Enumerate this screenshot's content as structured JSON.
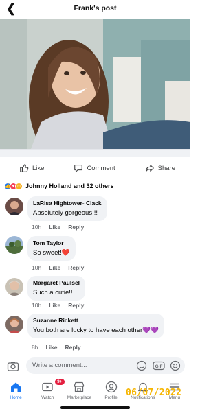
{
  "header": {
    "title": "Frank's post"
  },
  "actions": {
    "like": "Like",
    "comment": "Comment",
    "share": "Share"
  },
  "reactions": {
    "summary": "Johnny Holland and 32 others"
  },
  "comments": [
    {
      "name": "LaRisa Hightower- Clack",
      "text": "Absolutely gorgeous!!!",
      "time": "10h",
      "like": "Like",
      "reply": "Reply"
    },
    {
      "name": "Tom Taylor",
      "text": "So sweet!❤️",
      "time": "10h",
      "like": "Like",
      "reply": "Reply"
    },
    {
      "name": "Margaret Paulsel",
      "text": "Such a cutie!!",
      "time": "10h",
      "like": "Like",
      "reply": "Reply"
    },
    {
      "name": "Suzanne Rickett",
      "text": "You both are lucky to have each other💜💜",
      "time": "8h",
      "like": "Like",
      "reply": "Reply"
    }
  ],
  "composer": {
    "placeholder": "Write a comment..."
  },
  "tabs": [
    {
      "label": "Home"
    },
    {
      "label": "Watch",
      "badge": "9+"
    },
    {
      "label": "Marketplace"
    },
    {
      "label": "Profile"
    },
    {
      "label": "Notifications"
    },
    {
      "label": "Menu"
    }
  ],
  "stamp": "06/07/2022",
  "colors": {
    "accent": "#1877f2",
    "badge": "#e41e3f",
    "bubble": "#f0f2f5",
    "stamp": "#f6b500"
  }
}
